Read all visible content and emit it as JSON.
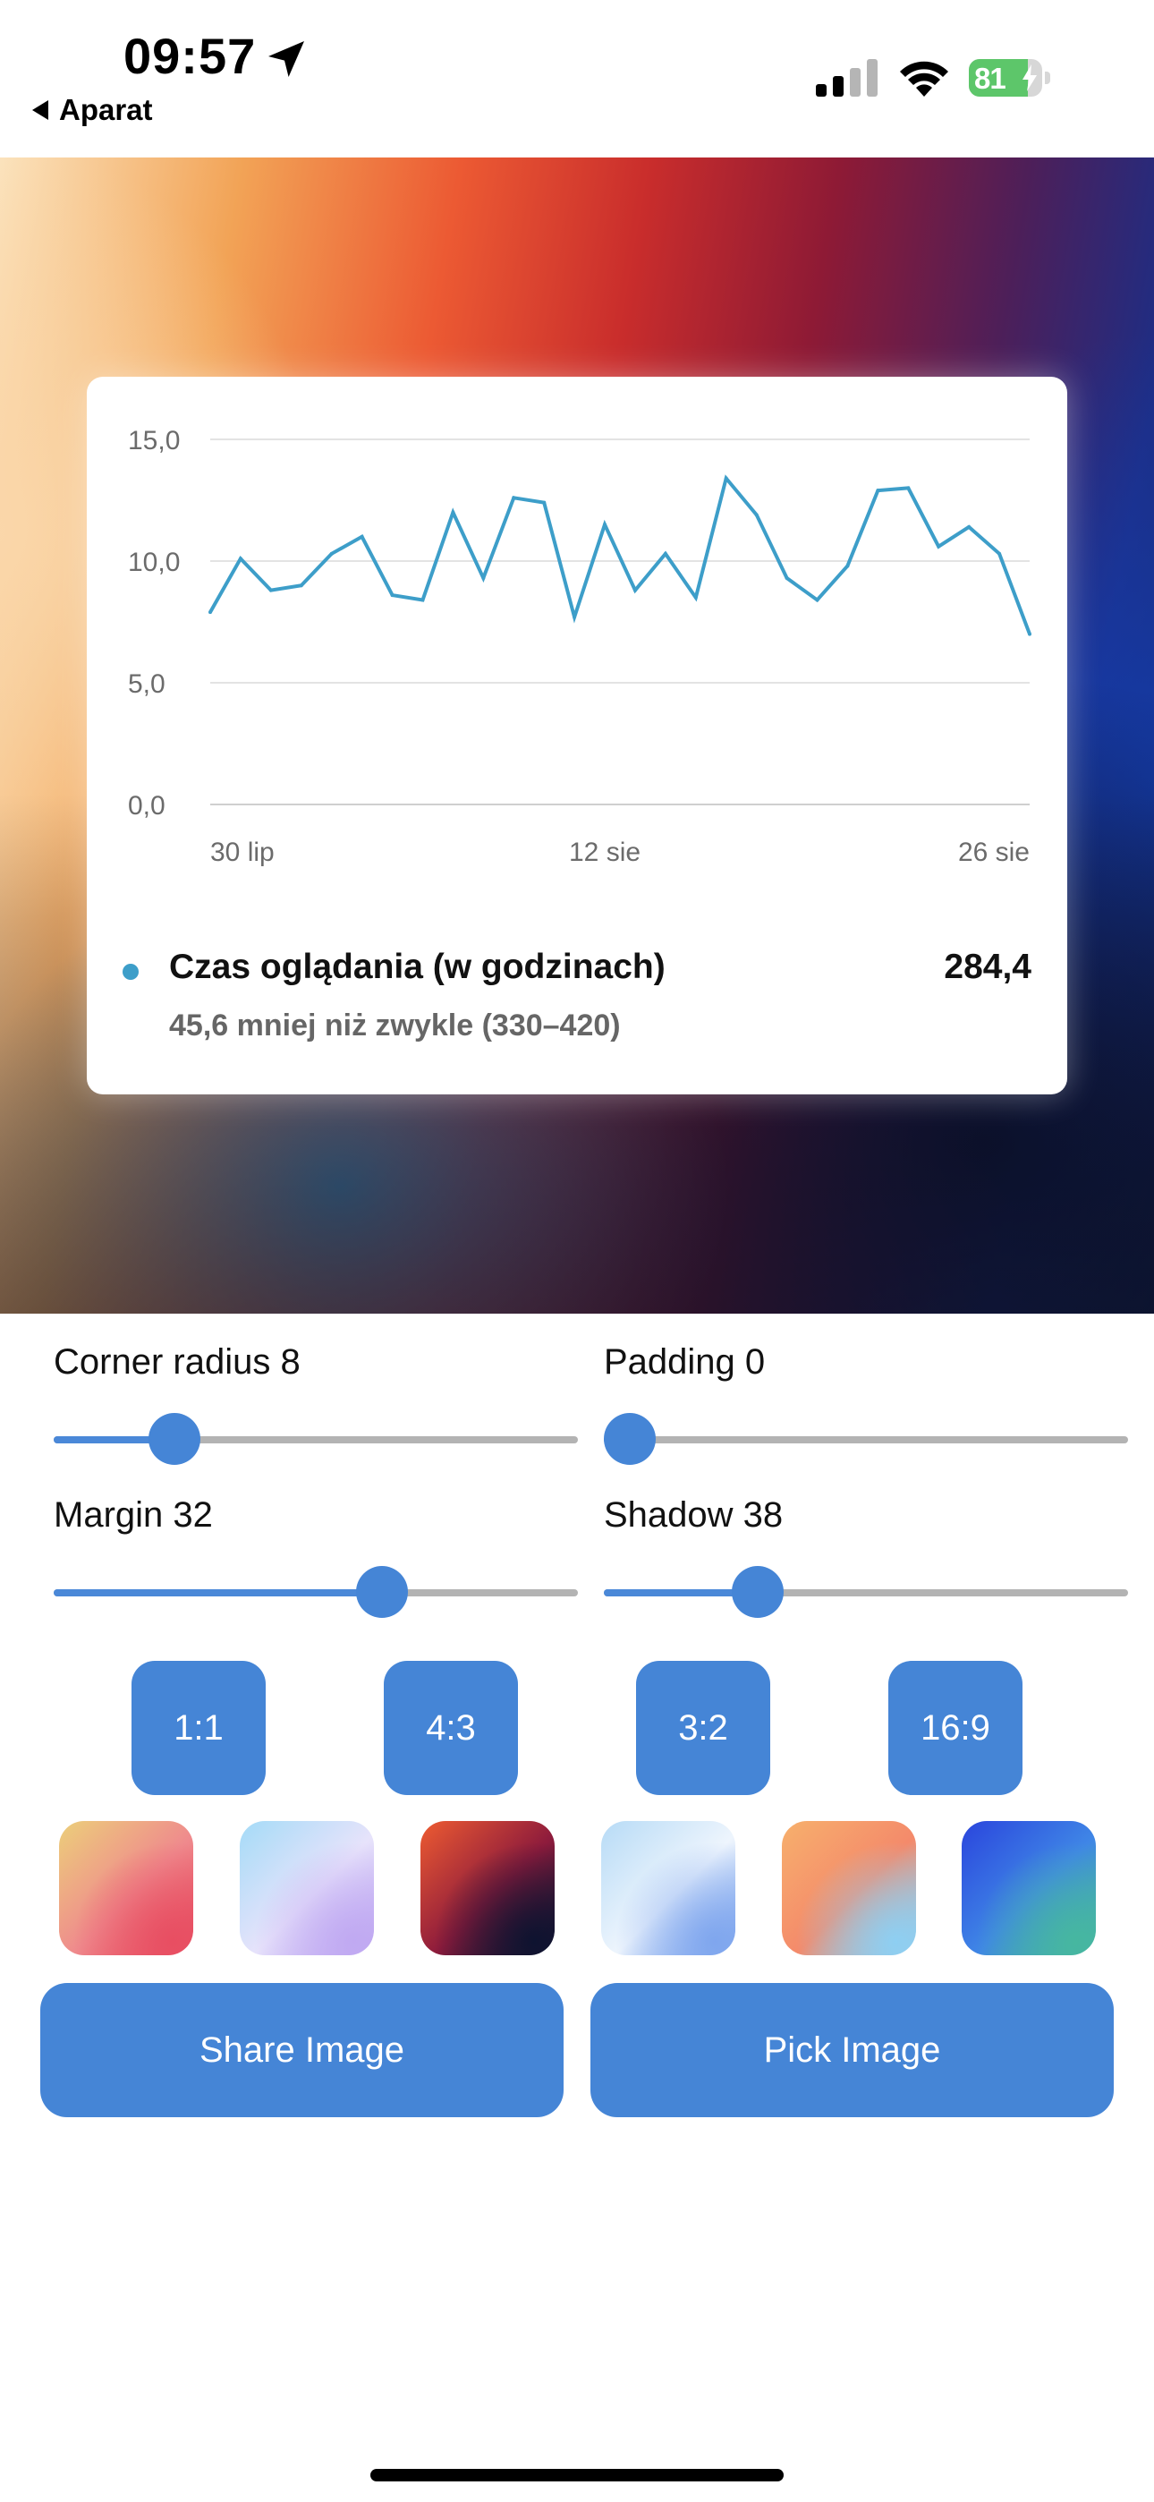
{
  "status_bar": {
    "time": "09:57",
    "back_label": "Aparat",
    "battery_percent": 81,
    "battery_text": "81",
    "signal_bars_active": 2,
    "signal_bars_total": 4
  },
  "card": {
    "legend": {
      "label": "Czas oglądania (w godzinach)",
      "value": "284,4",
      "subtitle": "45,6 mniej niż zwykle (330–420)",
      "color": "#3d9ec9"
    }
  },
  "chart_data": {
    "type": "line",
    "y_ticks": [
      "15,0",
      "10,0",
      "5,0",
      "0,0"
    ],
    "y_tick_values": [
      15,
      10,
      5,
      0
    ],
    "ylim": [
      0,
      15
    ],
    "x_ticks": [
      "30 lip",
      "12 sie",
      "26 sie"
    ],
    "x_tick_indices": [
      0,
      13,
      27
    ],
    "grid": true,
    "series": [
      {
        "color": "#3d9ec9",
        "values": [
          7.9,
          10.1,
          8.8,
          9.0,
          10.3,
          11.0,
          8.6,
          8.4,
          12.0,
          9.3,
          12.6,
          12.4,
          7.7,
          11.5,
          8.8,
          10.3,
          8.5,
          13.4,
          11.9,
          9.3,
          8.4,
          9.8,
          12.9,
          13.0,
          10.6,
          11.4,
          10.3,
          7.0
        ]
      }
    ]
  },
  "controls": {
    "corner_radius": {
      "label": "Corner radius 8",
      "value": 8,
      "min": 0,
      "max": 40
    },
    "padding": {
      "label": "Padding 0",
      "value": 0,
      "min": 0,
      "max": 40
    },
    "margin": {
      "label": "Margin 32",
      "value": 32,
      "min": 0,
      "max": 50
    },
    "shadow": {
      "label": "Shadow 38",
      "value": 38,
      "min": 0,
      "max": 140
    }
  },
  "aspect_ratios": [
    "1:1",
    "4:3",
    "3:2",
    "16:9"
  ],
  "backgrounds": [
    {
      "name": "warm-sunset-swatch",
      "colors": [
        "#eccf7a",
        "#ef8a8d",
        "#e84e62"
      ]
    },
    {
      "name": "pastel-sky-swatch",
      "colors": [
        "#a4dbf7",
        "#e7e3fb",
        "#c0a9f2"
      ]
    },
    {
      "name": "red-navy-swatch",
      "colors": [
        "#ee5b31",
        "#8d1b3c",
        "#0e1330"
      ]
    },
    {
      "name": "icy-blue-swatch",
      "colors": [
        "#b7dbf6",
        "#eef5fd",
        "#7fa6ee"
      ]
    },
    {
      "name": "orange-cyan-swatch",
      "colors": [
        "#f7b06c",
        "#f48a6b",
        "#8ecff2"
      ]
    },
    {
      "name": "deep-blue-swatch",
      "colors": [
        "#2a45dd",
        "#3f86e6",
        "#46b7a0"
      ]
    }
  ],
  "actions": {
    "share_label": "Share Image",
    "pick_label": "Pick Image"
  },
  "colors": {
    "accent": "#4585d6",
    "slider_track": "#b3b3b3",
    "battery_green": "#5dc66a"
  }
}
